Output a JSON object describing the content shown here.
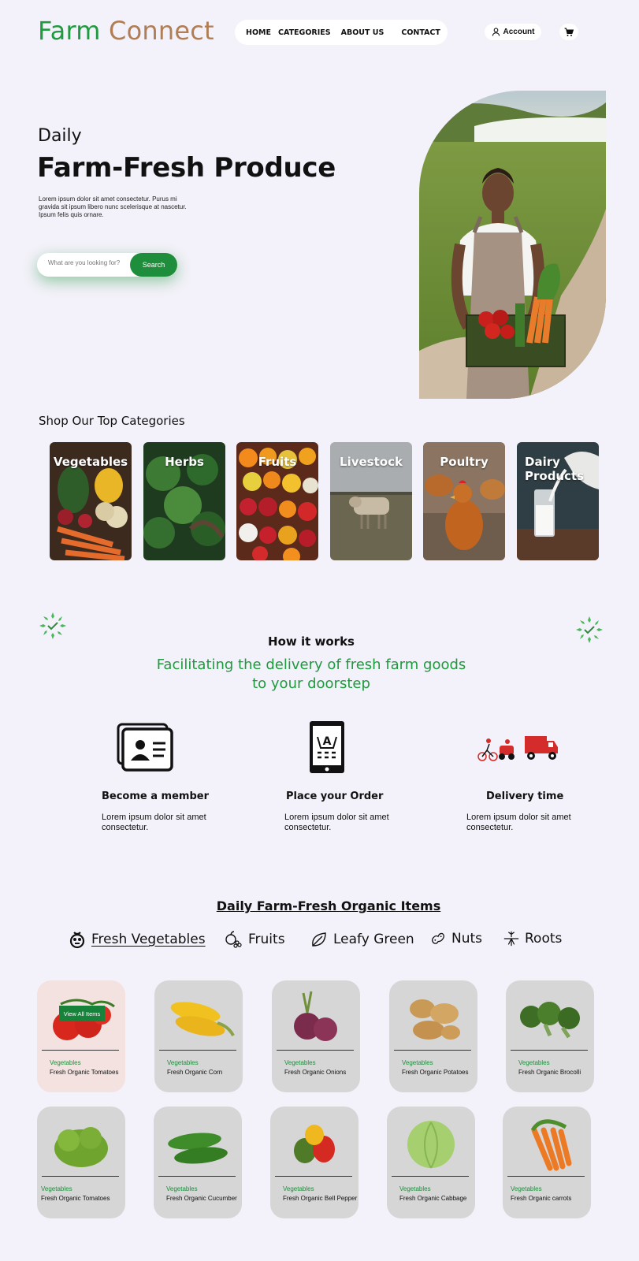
{
  "header": {
    "logo_part1": "Farm",
    "logo_part2": "Connect",
    "nav": [
      "HOME",
      "CATEGORIES",
      "ABOUT US",
      "CONTACT"
    ],
    "account_label": "Account",
    "account_icon": "user-icon",
    "cart_icon": "cart-icon"
  },
  "hero": {
    "kicker": "Daily",
    "headline": "Farm-Fresh Produce",
    "description": "Lorem ipsum dolor sit amet consectetur. Purus mi gravida sit ipsum libero nunc scelerisque at nascetur. Ipsum felis quis ornare.",
    "search_placeholder": "What are you looking for?",
    "search_button": "Search"
  },
  "categories": {
    "title": "Shop Our Top Categories",
    "items": [
      "Vegetables",
      "Herbs",
      "Fruits",
      "Livestock",
      "Poultry",
      "Dairy Products"
    ]
  },
  "how_it_works": {
    "title": "How it works",
    "subtitle_line1": "Facilitating the delivery of fresh farm goods",
    "subtitle_line2": "to your doorstep",
    "steps": [
      {
        "title": "Become a member",
        "desc": "Lorem ipsum dolor sit amet consectetur.",
        "icon": "member-card-icon"
      },
      {
        "title": "Place your Order",
        "desc": "Lorem ipsum dolor sit amet consectetur.",
        "icon": "mobile-cart-icon"
      },
      {
        "title": "Delivery time",
        "desc": "Lorem ipsum dolor sit amet consectetur.",
        "icon": "delivery-truck-icon"
      }
    ]
  },
  "organic": {
    "title": "Daily Farm-Fresh Organic Items",
    "tabs": [
      {
        "label": "Fresh Vegetables",
        "icon": "vegetable-icon",
        "active": true
      },
      {
        "label": "Fruits",
        "icon": "fruit-icon"
      },
      {
        "label": "Leafy Green",
        "icon": "leaf-icon"
      },
      {
        "label": "Nuts",
        "icon": "nut-icon"
      },
      {
        "label": "Roots",
        "icon": "root-icon"
      }
    ],
    "view_all_label": "View All Items",
    "products": [
      {
        "category": "Vegetables",
        "name": "Fresh Organic Tomatoes"
      },
      {
        "category": "Vegetables",
        "name": "Fresh Organic Corn"
      },
      {
        "category": "Vegetables",
        "name": "Fresh Organic Onions"
      },
      {
        "category": "Vegetables",
        "name": "Fresh Organic Potatoes"
      },
      {
        "category": "Vegetables",
        "name": "Fresh Organic Brocolli"
      },
      {
        "category": "Vegetables",
        "name": "Fresh Organic Tomatoes"
      },
      {
        "category": "Vegetables",
        "name": "Fresh Organic Cucumber"
      },
      {
        "category": "Vegetables",
        "name": "Fresh Organic Bell Pepper"
      },
      {
        "category": "Vegetables",
        "name": "Fresh Organic Cabbage"
      },
      {
        "category": "Vegetables",
        "name": "Fresh Organic carrots"
      }
    ]
  },
  "colors": {
    "brand_green": "#1f9a3e",
    "brand_brown": "#b07d54",
    "background": "#f3f1f9"
  }
}
